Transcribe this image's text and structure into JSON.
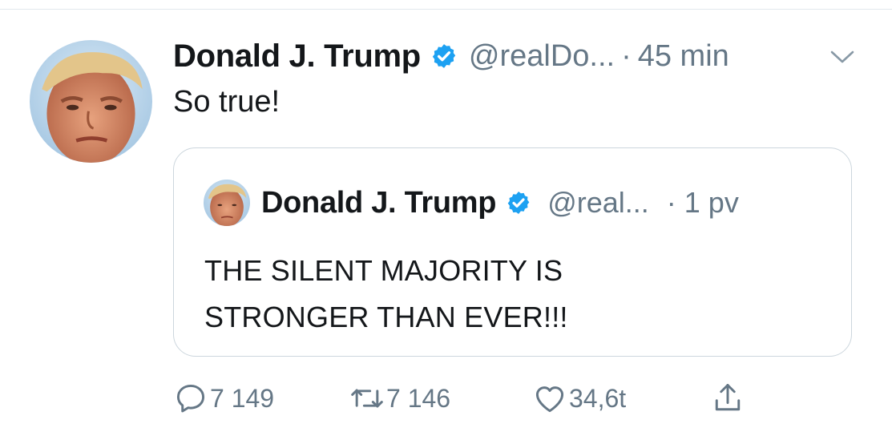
{
  "tweet": {
    "author_name": "Donald J. Trump",
    "handle": "@realDo...",
    "separator": "·",
    "time": "45 min",
    "text": "So true!",
    "avatar_icon": "profile-photo-icon",
    "verified_icon": "verified-badge-icon",
    "menu_icon": "chevron-down-icon"
  },
  "quoted_tweet": {
    "author_name": "Donald J. Trump",
    "handle": "@real...",
    "time": "· 1 pv",
    "text_lines": [
      "THE SILENT MAJORITY IS",
      "STRONGER THAN EVER!!!"
    ],
    "avatar_icon": "profile-photo-icon",
    "verified_icon": "verified-badge-icon"
  },
  "actions": {
    "reply": {
      "icon": "reply-icon",
      "count": "7 149"
    },
    "retweet": {
      "icon": "retweet-icon",
      "count": "7 146"
    },
    "like": {
      "icon": "heart-icon",
      "count": "34,6t"
    },
    "share": {
      "icon": "share-icon"
    }
  },
  "colors": {
    "text": "#14171a",
    "secondary": "#657786",
    "verified": "#1da1f2",
    "border": "#ccd6dd"
  }
}
